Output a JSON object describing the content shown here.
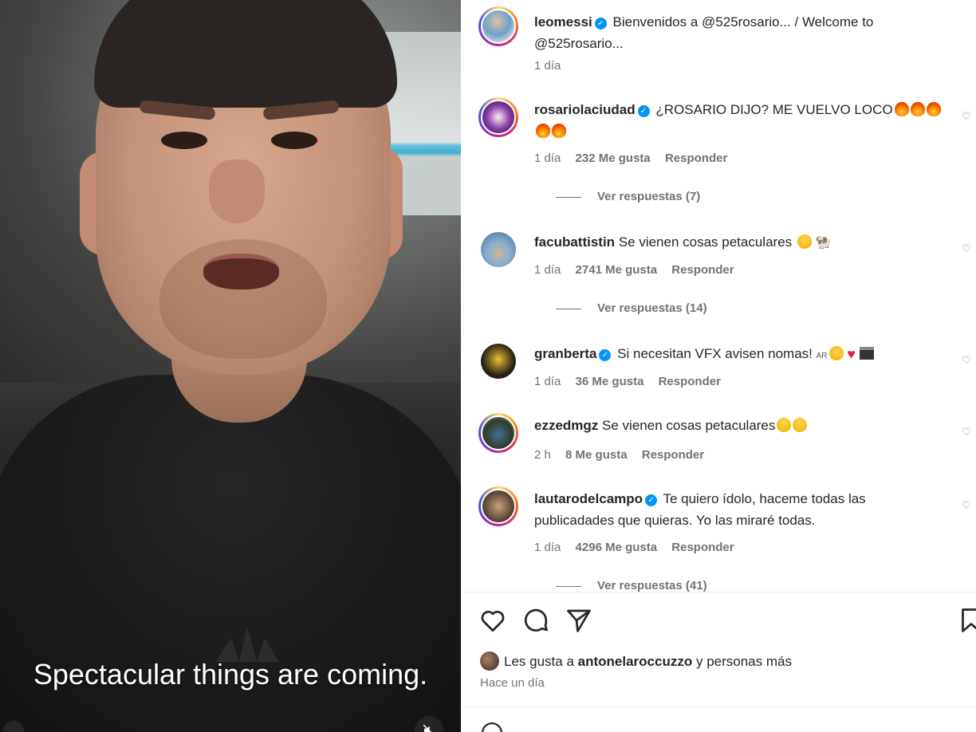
{
  "video": {
    "caption": "Spectacular things are coming.",
    "mute_icon": "muted-speaker-icon"
  },
  "post": {
    "author": "leomessi",
    "verified": true,
    "caption_text": "Bienvenidos a @525rosario... / Welcome to @525rosario...",
    "time": "1 día"
  },
  "comments": [
    {
      "user": "rosariolaciudad",
      "verified": true,
      "text": "¿ROSARIO DIJO? ME VUELVO LOCO",
      "emojis": [
        "fire",
        "fire",
        "fire",
        "fire",
        "fire"
      ],
      "time": "1 día",
      "likes": "232 Me gusta",
      "reply": "Responder",
      "view_replies": "Ver respuestas (7)"
    },
    {
      "user": "facubattistin",
      "verified": false,
      "text": "Se vienen cosas petaculares",
      "emojis": [
        "smiling-face-hearts",
        "ram"
      ],
      "time": "1 día",
      "likes": "2741 Me gusta",
      "reply": "Responder",
      "view_replies": "Ver respuestas (14)"
    },
    {
      "user": "granberta",
      "verified": true,
      "text": "Si necesitan VFX avisen nomas!",
      "emoji_prefix": "AR",
      "emojis": [
        "screaming-face",
        "red-heart",
        "clapper-board"
      ],
      "time": "1 día",
      "likes": "36 Me gusta",
      "reply": "Responder"
    },
    {
      "user": "ezzedmgz",
      "verified": false,
      "text": "Se vienen cosas petaculares",
      "emojis": [
        "grinning-sweat",
        "grinning-sweat"
      ],
      "time": "2 h",
      "likes": "8 Me gusta",
      "reply": "Responder"
    },
    {
      "user": "lautarodelcampo",
      "verified": true,
      "text": "Te quiero ídolo, haceme todas las publicadades que quieras. Yo las miraré todas.",
      "time": "1 día",
      "likes": "4296 Me gusta",
      "reply": "Responder",
      "view_replies": "Ver respuestas (41)"
    }
  ],
  "actions": {
    "like_icon": "heart-icon",
    "comment_icon": "comment-icon",
    "share_icon": "send-icon",
    "save_icon": "bookmark-icon"
  },
  "likes_summary": {
    "prefix": "Les gusta a",
    "user": "antonelaroccuzzo",
    "suffix": "y personas más"
  },
  "posted_ago": "Hace un día",
  "colors": {
    "verified_blue": "#0095f6",
    "muted_text": "#737373",
    "primary_text": "#262626"
  }
}
